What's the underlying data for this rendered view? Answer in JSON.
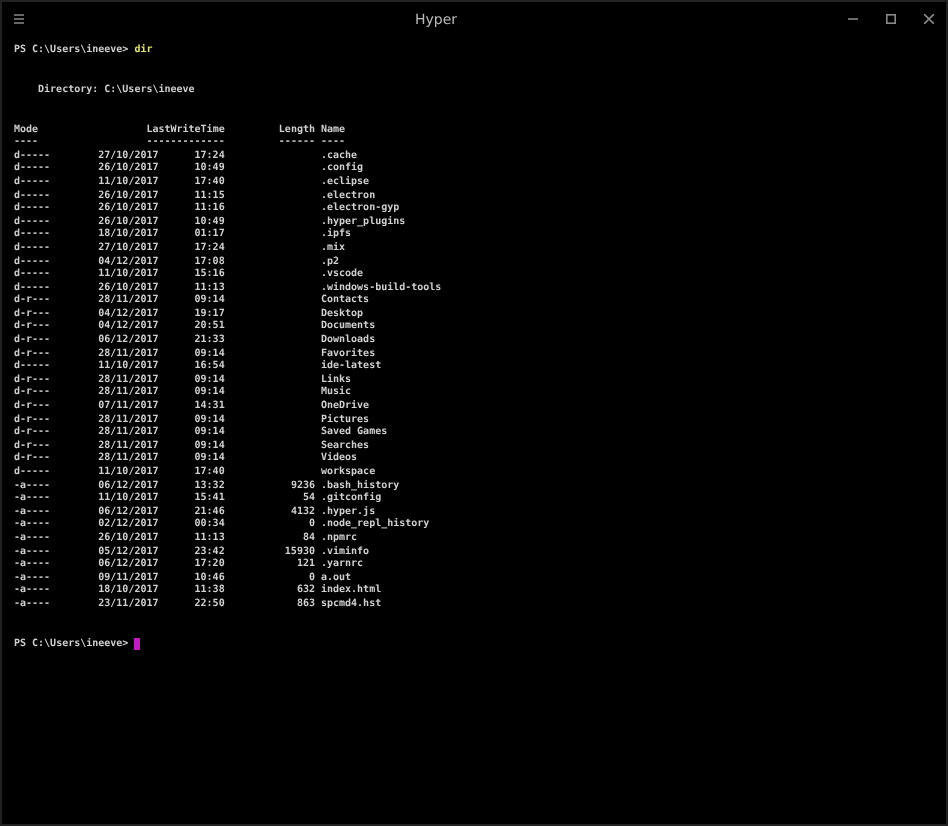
{
  "window": {
    "title": "Hyper"
  },
  "terminal": {
    "prompt": "PS C:\\Users\\ineeve>",
    "command": "dir",
    "directory_label": "Directory: C:\\Users\\ineeve",
    "columns": [
      "Mode",
      "LastWriteTime",
      "Length",
      "Name"
    ],
    "underlines": [
      "----",
      "-------------",
      "------",
      "----"
    ],
    "rows": [
      {
        "mode": "d-----",
        "date": "27/10/2017",
        "time": "17:24",
        "name": ".cache"
      },
      {
        "mode": "d-----",
        "date": "26/10/2017",
        "time": "10:49",
        "name": ".config"
      },
      {
        "mode": "d-----",
        "date": "11/10/2017",
        "time": "17:40",
        "name": ".eclipse"
      },
      {
        "mode": "d-----",
        "date": "26/10/2017",
        "time": "11:15",
        "name": ".electron"
      },
      {
        "mode": "d-----",
        "date": "26/10/2017",
        "time": "11:16",
        "name": ".electron-gyp"
      },
      {
        "mode": "d-----",
        "date": "26/10/2017",
        "time": "10:49",
        "name": ".hyper_plugins"
      },
      {
        "mode": "d-----",
        "date": "18/10/2017",
        "time": "01:17",
        "name": ".ipfs"
      },
      {
        "mode": "d-----",
        "date": "27/10/2017",
        "time": "17:24",
        "name": ".mix"
      },
      {
        "mode": "d-----",
        "date": "04/12/2017",
        "time": "17:08",
        "name": ".p2"
      },
      {
        "mode": "d-----",
        "date": "11/10/2017",
        "time": "15:16",
        "name": ".vscode"
      },
      {
        "mode": "d-----",
        "date": "26/10/2017",
        "time": "11:13",
        "name": ".windows-build-tools"
      },
      {
        "mode": "d-r---",
        "date": "28/11/2017",
        "time": "09:14",
        "name": "Contacts"
      },
      {
        "mode": "d-r---",
        "date": "04/12/2017",
        "time": "19:17",
        "name": "Desktop"
      },
      {
        "mode": "d-r---",
        "date": "04/12/2017",
        "time": "20:51",
        "name": "Documents"
      },
      {
        "mode": "d-r---",
        "date": "06/12/2017",
        "time": "21:33",
        "name": "Downloads"
      },
      {
        "mode": "d-r---",
        "date": "28/11/2017",
        "time": "09:14",
        "name": "Favorites"
      },
      {
        "mode": "d-----",
        "date": "11/10/2017",
        "time": "16:54",
        "name": "ide-latest"
      },
      {
        "mode": "d-r---",
        "date": "28/11/2017",
        "time": "09:14",
        "name": "Links"
      },
      {
        "mode": "d-r---",
        "date": "28/11/2017",
        "time": "09:14",
        "name": "Music"
      },
      {
        "mode": "d-r---",
        "date": "07/11/2017",
        "time": "14:31",
        "name": "OneDrive"
      },
      {
        "mode": "d-r---",
        "date": "28/11/2017",
        "time": "09:14",
        "name": "Pictures"
      },
      {
        "mode": "d-r---",
        "date": "28/11/2017",
        "time": "09:14",
        "name": "Saved Games"
      },
      {
        "mode": "d-r---",
        "date": "28/11/2017",
        "time": "09:14",
        "name": "Searches"
      },
      {
        "mode": "d-r---",
        "date": "28/11/2017",
        "time": "09:14",
        "name": "Videos"
      },
      {
        "mode": "d-----",
        "date": "11/10/2017",
        "time": "17:40",
        "name": "workspace"
      },
      {
        "mode": "-a----",
        "date": "06/12/2017",
        "time": "13:32",
        "length": "9236",
        "name": ".bash_history"
      },
      {
        "mode": "-a----",
        "date": "11/10/2017",
        "time": "15:41",
        "length": "54",
        "name": ".gitconfig"
      },
      {
        "mode": "-a----",
        "date": "06/12/2017",
        "time": "21:46",
        "length": "4132",
        "name": ".hyper.js"
      },
      {
        "mode": "-a----",
        "date": "02/12/2017",
        "time": "00:34",
        "length": "0",
        "name": ".node_repl_history"
      },
      {
        "mode": "-a----",
        "date": "26/10/2017",
        "time": "11:13",
        "length": "84",
        "name": ".npmrc"
      },
      {
        "mode": "-a----",
        "date": "05/12/2017",
        "time": "23:42",
        "length": "15930",
        "name": ".viminfo"
      },
      {
        "mode": "-a----",
        "date": "06/12/2017",
        "time": "17:20",
        "length": "121",
        "name": ".yarnrc"
      },
      {
        "mode": "-a----",
        "date": "09/11/2017",
        "time": "10:46",
        "length": "0",
        "name": "a.out"
      },
      {
        "mode": "-a----",
        "date": "18/10/2017",
        "time": "11:38",
        "length": "632",
        "name": "index.html"
      },
      {
        "mode": "-a----",
        "date": "23/11/2017",
        "time": "22:50",
        "length": "863",
        "name": "spcmd4.hst"
      }
    ],
    "final_prompt": "PS C:\\Users\\ineeve>",
    "cursor_visible": true
  }
}
